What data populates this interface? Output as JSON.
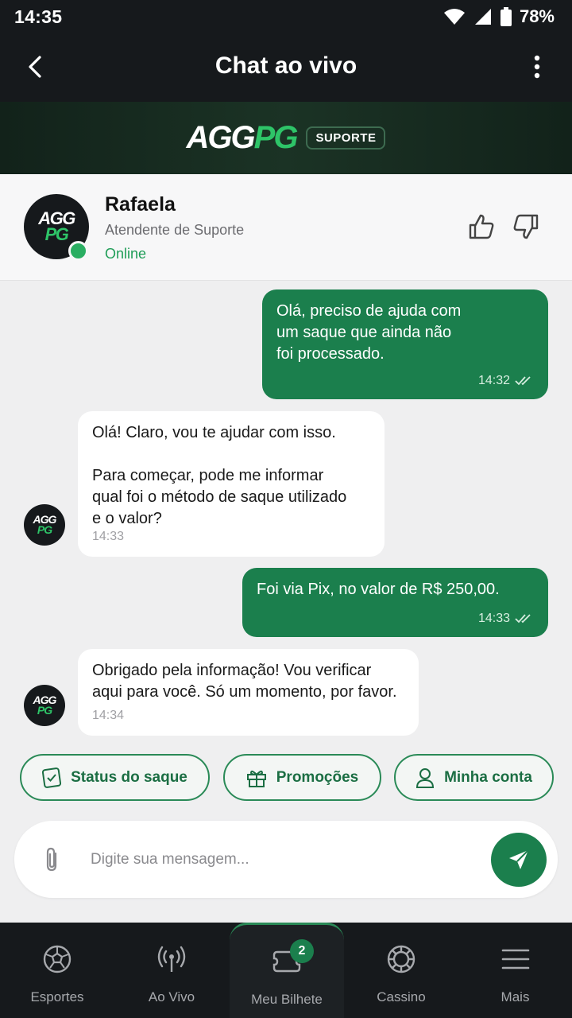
{
  "status_bar": {
    "time": "14:35",
    "battery": "78%"
  },
  "app_bar": {
    "title": "Chat ao vivo"
  },
  "brand": {
    "logo_white": "AGG",
    "logo_green": "PG",
    "badge": "SUPORTE"
  },
  "agent": {
    "avatar_white": "AGG",
    "avatar_green": "PG",
    "name": "Rafaela",
    "role": "Atendente de Suporte",
    "status": "Online"
  },
  "messages": [
    {
      "direction": "out",
      "text": "Olá, preciso de ajuda com\num saque que ainda não\nfoi processado.",
      "time": "14:32"
    },
    {
      "direction": "in",
      "text": "Olá! Claro, vou te ajudar com isso.\n\nPara começar, pode me informar\nqual foi o método de saque utilizado\ne o valor?",
      "time": "14:33"
    },
    {
      "direction": "out",
      "text": "Foi via Pix, no valor de R$ 250,00.",
      "time": "14:33"
    },
    {
      "direction": "in",
      "text": "Obrigado pela informação! Vou verificar\naqui para você. Só um momento, por favor.",
      "time": "14:34"
    }
  ],
  "quick_replies": [
    {
      "label": "Status do saque",
      "icon": "receipt-check-icon"
    },
    {
      "label": "Promoções",
      "icon": "gift-icon"
    },
    {
      "label": "Minha conta",
      "icon": "user-icon"
    }
  ],
  "composer": {
    "placeholder": "Digite sua mensagem..."
  },
  "bottom_nav": {
    "items": [
      {
        "label": "Esportes",
        "icon": "soccer-ball-icon"
      },
      {
        "label": "Ao Vivo",
        "icon": "broadcast-icon"
      },
      {
        "label": "Meu Bilhete",
        "icon": "ticket-icon",
        "badge": "2",
        "active": true
      },
      {
        "label": "Cassino",
        "icon": "casino-chip-icon"
      },
      {
        "label": "Mais",
        "icon": "menu-icon"
      }
    ]
  },
  "colors": {
    "accent": "#1b7f4d",
    "brand_green": "#2ec468",
    "dark": "#16191c",
    "online": "#2aae62"
  }
}
